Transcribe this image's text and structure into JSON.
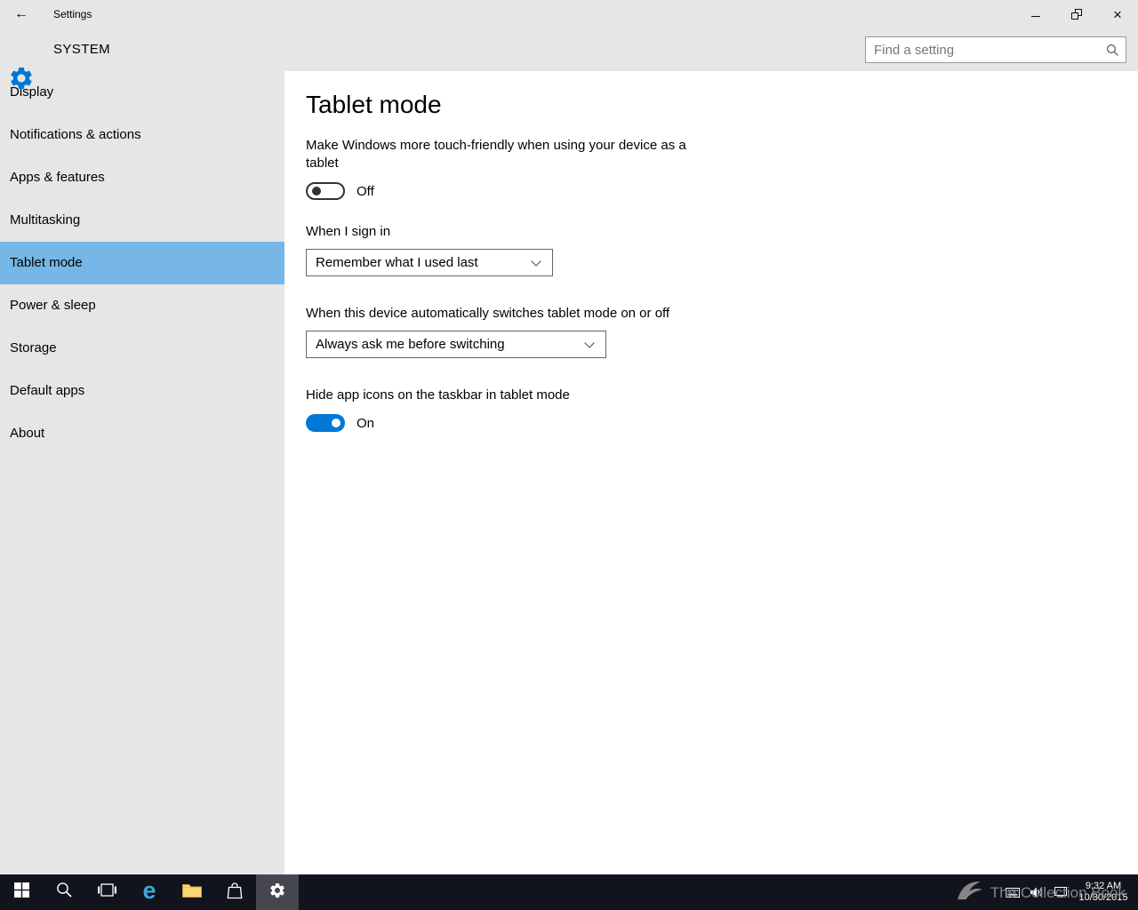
{
  "titlebar": {
    "title": "Settings"
  },
  "icons": {
    "back": "←",
    "close": "×",
    "minimize": "minimize-line-shape",
    "maximize": "restore-double-square-shape",
    "edge": "e",
    "header_gear": "settings-gear",
    "search": "magnifier",
    "taskbar": [
      "start-windows-logo",
      "search-magnifier",
      "task-view",
      "edge-e",
      "file-explorer-folder",
      "store-bag",
      "settings-gear"
    ],
    "tray": [
      "touch-keyboard",
      "volume-speaker",
      "network-display"
    ]
  },
  "header": {
    "app_title": "SYSTEM",
    "search_placeholder": "Find a setting"
  },
  "sidebar": {
    "items": [
      {
        "label": "Display",
        "selected": false
      },
      {
        "label": "Notifications & actions",
        "selected": false
      },
      {
        "label": "Apps & features",
        "selected": false
      },
      {
        "label": "Multitasking",
        "selected": false
      },
      {
        "label": "Tablet mode",
        "selected": true
      },
      {
        "label": "Power & sleep",
        "selected": false
      },
      {
        "label": "Storage",
        "selected": false
      },
      {
        "label": "Default apps",
        "selected": false
      },
      {
        "label": "About",
        "selected": false
      }
    ]
  },
  "main": {
    "page_title": "Tablet mode",
    "touch_toggle": {
      "label": "Make Windows more touch-friendly when using your device as a tablet",
      "value": "Off"
    },
    "signin_dropdown": {
      "label": "When I sign in",
      "value": "Remember what I used last"
    },
    "switch_dropdown": {
      "label": "When this device automatically switches tablet mode on or off",
      "value": "Always ask me before switching"
    },
    "hide_icons_toggle": {
      "label": "Hide app icons on the taskbar in tablet mode",
      "value": "On"
    }
  },
  "taskbar": {
    "tray": {
      "time": "9:32 AM",
      "date": "10/30/2015"
    },
    "watermark": "The Collection Book"
  },
  "colors": {
    "accent": "#0078d7",
    "sidebar_selected": "#77b7e7",
    "chrome_gray": "#e6e6e6",
    "taskbar_bg": "#11131d"
  }
}
